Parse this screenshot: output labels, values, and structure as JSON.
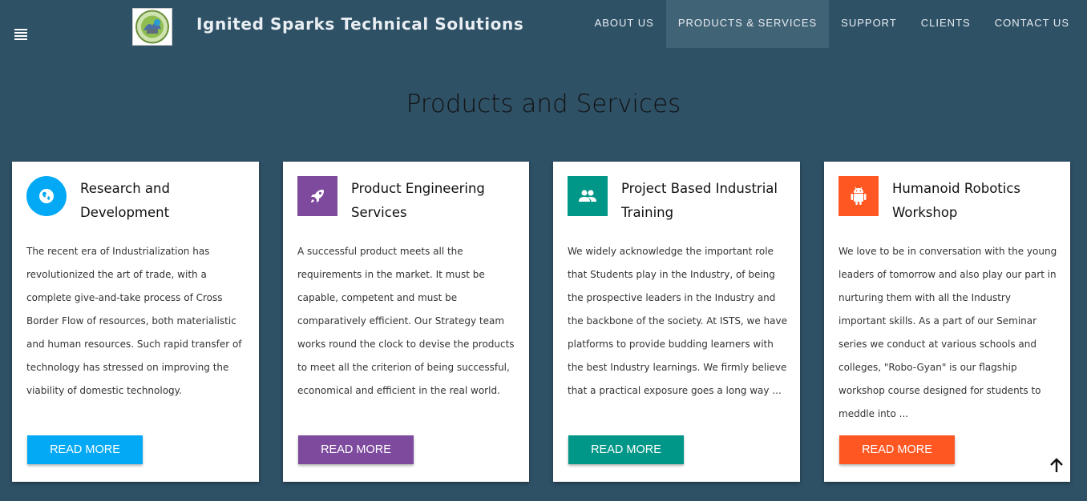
{
  "header": {
    "brand": "Ignited Sparks Technical Solutions",
    "nav": [
      {
        "label": "ABOUT US"
      },
      {
        "label": "PRODUCTS & SERVICES"
      },
      {
        "label": "SUPPORT"
      },
      {
        "label": "CLIENTS"
      },
      {
        "label": "CONTACT US"
      }
    ]
  },
  "main": {
    "title": "Products and Services",
    "cards": [
      {
        "title": "Research and Development",
        "text": "The recent era of Industrialization has revolutionized the art of trade, with a complete give-and-take process of Cross Border Flow of resources, both materialistic and human resources. Such rapid transfer of technology has stressed on improving the viability of domestic technology.",
        "button": "READ MORE",
        "icon": "globe-icon",
        "color": "#03a9f4"
      },
      {
        "title": "Product Engineering Services",
        "text": "A successful product meets all the requirements in the market. It must be capable, competent and must be comparatively efficient. Our Strategy team works round the clock to devise the products to meet all the criterion of being successful, economical and efficient in the real world.",
        "button": "READ MORE",
        "icon": "rocket-icon",
        "color": "#7e4a9d"
      },
      {
        "title": "Project Based Industrial Training",
        "text": "We widely acknowledge the important role that Students play in the Industry, of being the prospective leaders in the Industry and the backbone of the society. At ISTS, we have platforms to provide budding learners with the best Industry learnings. We firmly believe that a practical exposure goes a long way ...",
        "button": "READ MORE",
        "icon": "people-icon",
        "color": "#009688"
      },
      {
        "title": "Humanoid Robotics Workshop",
        "text": "We love to be in conversation with the young leaders of tomorrow and also play our part in nurturing them with all the Industry important skills. As a part of our Seminar series we conduct at various schools and colleges, \"Robo-Gyan\" is our flagship workshop course designed for students to meddle into ...",
        "button": "READ MORE",
        "icon": "android-icon",
        "color": "#ff5722"
      }
    ]
  }
}
